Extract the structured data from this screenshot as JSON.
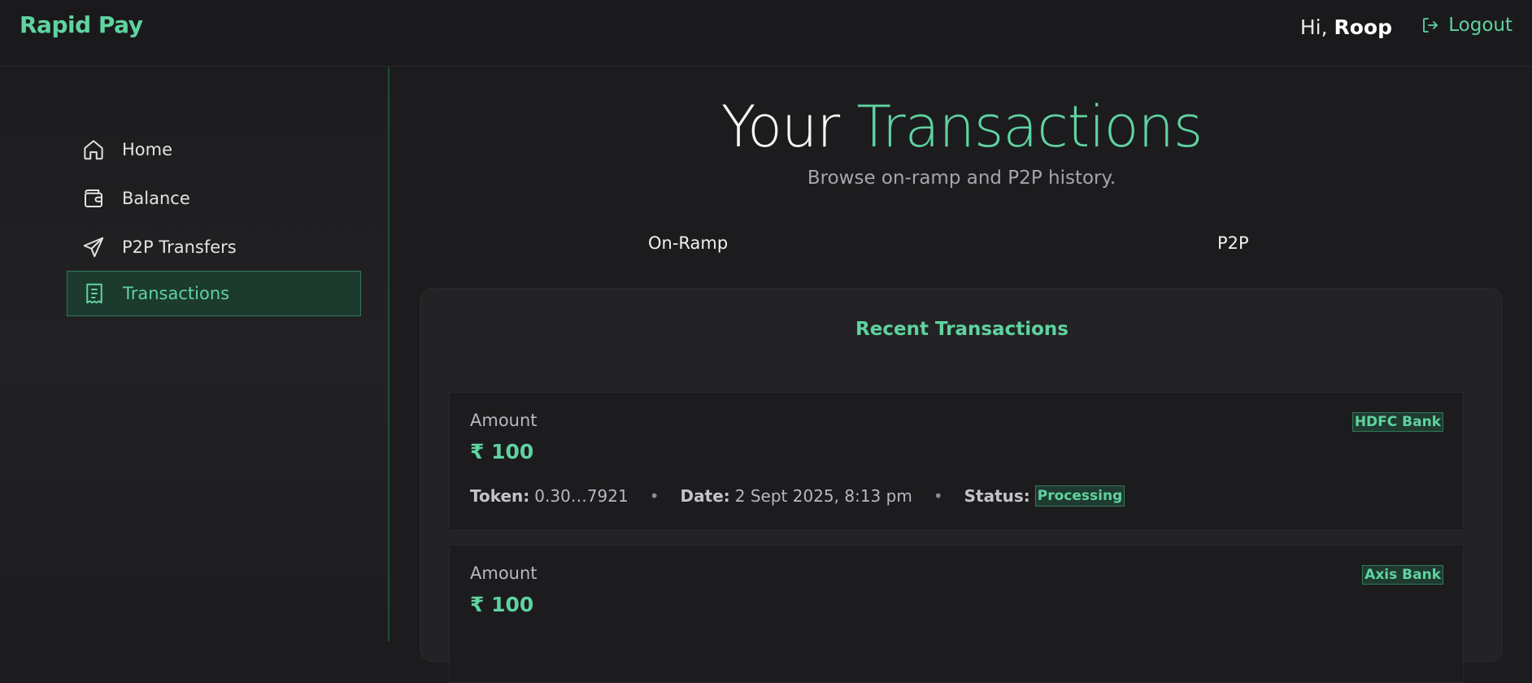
{
  "header": {
    "brand": "Rapid Pay",
    "greeting_prefix": "Hi,",
    "user_name": "Roop",
    "logout_label": "Logout"
  },
  "sidebar": {
    "items": [
      {
        "label": "Home",
        "icon": "home-icon"
      },
      {
        "label": "Balance",
        "icon": "wallet-icon"
      },
      {
        "label": "P2P Transfers",
        "icon": "send-icon"
      },
      {
        "label": "Transactions",
        "icon": "receipt-icon",
        "active": true
      }
    ]
  },
  "main": {
    "title_plain": "Your",
    "title_accent": "Transactions",
    "subtitle": "Browse on-ramp and P2P history.",
    "tabs": [
      "On-Ramp",
      "P2P"
    ],
    "card_title": "Recent Transactions",
    "transactions": [
      {
        "amount_label": "Amount",
        "amount": "₹ 100",
        "bank": "HDFC Bank",
        "token_label": "Token:",
        "token": "0.30…7921",
        "date_label": "Date:",
        "date": "2 Sept 2025, 8:13 pm",
        "status_label": "Status:",
        "status": "Processing"
      },
      {
        "amount_label": "Amount",
        "amount": "₹ 100",
        "bank": "Axis Bank"
      }
    ]
  },
  "colors": {
    "accent": "#5fd3a0",
    "background": "#1c1c1e",
    "active_bg": "#1d3a2f"
  }
}
